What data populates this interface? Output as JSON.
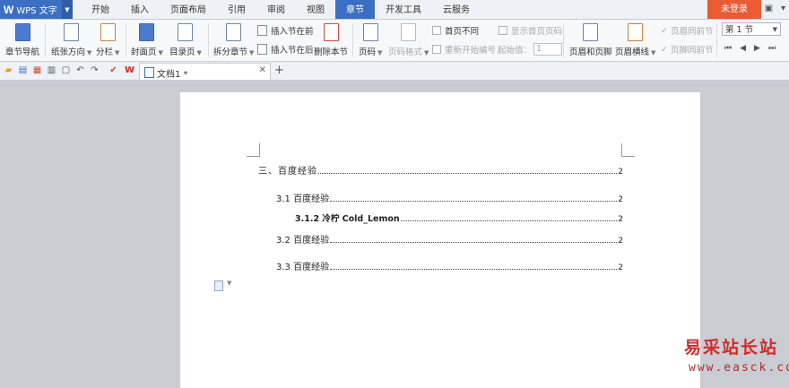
{
  "app": {
    "logo": "W",
    "name": "WPS 文字"
  },
  "tabs": [
    "开始",
    "插入",
    "页面布局",
    "引用",
    "审阅",
    "视图",
    "章节",
    "开发工具",
    "云服务"
  ],
  "active_tab": "章节",
  "login_label": "未登录",
  "ribbon": {
    "section_nav": "章节导航",
    "paper_orientation": "纸张方向",
    "columns": "分栏",
    "cover_page": "封面页",
    "toc_page": "目录页",
    "split_section": "拆分章节",
    "insert_section_before": "插入节在前",
    "insert_section_after": "插入节在后",
    "delete_section": "删除本节",
    "page_number": "页码",
    "page_number_format": "页码格式",
    "different_first_page": "首页不同",
    "show_first_page_number": "显示首页页码",
    "restart_numbering": "重新开始编号",
    "start_value_label": "起始值：",
    "start_value": "1",
    "header_footer": "页眉和页脚",
    "header_line": "页眉横线",
    "header_same_as_prev": "页眉同前节",
    "footer_same_as_prev": "页脚同前节",
    "section_select": "第 1 节"
  },
  "document_tab": {
    "title": "文档1 *"
  },
  "toc": [
    {
      "text": "三、百度经验",
      "page": "2"
    },
    {
      "text": "3.1 百度经验",
      "page": "2"
    },
    {
      "text": "3.1.2 冷柠 Cold_Lemon",
      "page": "2"
    },
    {
      "text": "3.2 百度经验",
      "page": "2"
    },
    {
      "text": "3.3 百度经验",
      "page": "2"
    }
  ],
  "watermark": {
    "line1": "易采站长站",
    "line2": "www.easck.com"
  },
  "colors": {
    "accent": "#3a6fc4",
    "login": "#ea5a34",
    "watermark": "#d42a2a"
  }
}
